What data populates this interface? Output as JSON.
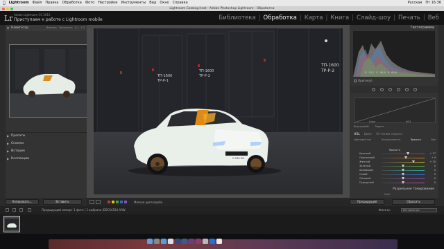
{
  "menubar": {
    "app": "Lightroom",
    "items": [
      "Файл",
      "Правка",
      "Обработка",
      "Фото",
      "Настройки",
      "Инструменты",
      "Вид",
      "Окно",
      "Справка"
    ],
    "right_items": [
      "Русская",
      "Пт 16:36"
    ]
  },
  "titlebar": {
    "title": "Lightroom Catalog.lrcat - Adobe Photoshop Lightroom - Обработка"
  },
  "identity": {
    "logo": "Lr",
    "catalog": "Adobe Lightroom CC 2015",
    "status": "Приступаем к работе с Lightroom mobile"
  },
  "modules": [
    {
      "label": "Библиотека",
      "active": false
    },
    {
      "label": "Обработка",
      "active": true
    },
    {
      "label": "Карта",
      "active": false
    },
    {
      "label": "Книга",
      "active": false
    },
    {
      "label": "Слайд-шоу",
      "active": false
    },
    {
      "label": "Печать",
      "active": false
    },
    {
      "label": "Веб",
      "active": false
    }
  ],
  "left_panel": {
    "navigator": "Навигатор",
    "nav_options": [
      "Вписать",
      "Заполнить",
      "1:1",
      "1:3"
    ],
    "sections": [
      "Пресеты",
      "Снимки",
      "История",
      "Коллекции"
    ]
  },
  "right_panel": {
    "histogram_title": "Гистограмма",
    "histogram_readout": [
      "R",
      "93,2",
      "G",
      "88,8",
      "B",
      "80,8"
    ],
    "original_label": "Оригинал",
    "curve_labels": [
      "Блик",
      "Ф03"
    ],
    "profile_label": "Вид кривой:",
    "profile_value": "Задать",
    "hsl_tabs": [
      "HSL",
      "Цвет",
      "Оттенки серого"
    ],
    "hsl_sub": [
      "Цветовой тон",
      "Насыщенность",
      "Яркость",
      "Все"
    ],
    "hsl_active": "Яркость",
    "section_title": "Яркость",
    "sliders": [
      {
        "label": "Красный",
        "value": "+ 17",
        "color": "#c0392b",
        "pos": 0.62
      },
      {
        "label": "Оранжевый",
        "value": "+ 9",
        "color": "#d7841f",
        "pos": 0.57
      },
      {
        "label": "Желтый",
        "value": "+ 30",
        "color": "#d9c21d",
        "pos": 0.74
      },
      {
        "label": "Зеленый",
        "value": "0",
        "color": "#4e9b2e",
        "pos": 0.5
      },
      {
        "label": "Аквамарин",
        "value": "0",
        "color": "#2fa39a",
        "pos": 0.5
      },
      {
        "label": "Синий",
        "value": "0",
        "color": "#2f6bc1",
        "pos": 0.5
      },
      {
        "label": "Лиловый",
        "value": "0",
        "color": "#8a4fc1",
        "pos": 0.5
      },
      {
        "label": "Пурпурный",
        "value": "0",
        "color": "#c14fa4",
        "pos": 0.5
      }
    ],
    "split_title": "Раздельное тонирование",
    "light_label": "Свет"
  },
  "toolbar": {
    "preset_label": "Мягкая цветопроба"
  },
  "bottom_buttons": {
    "copy": "Копировать...",
    "paste": "Вставить",
    "previous": "Предыдущий",
    "reset": "Сбросить"
  },
  "filmstrip": {
    "info": "Предыдущий импорт  1 фото / 1 выбрано /DSC04524.ARW",
    "filter_label": "Фильтр:",
    "filter_value": "Без фильтра"
  },
  "colors": {
    "panel_bg": "#333333",
    "center_bg": "#4a4a4a",
    "active_module": "#f0f0f0"
  }
}
